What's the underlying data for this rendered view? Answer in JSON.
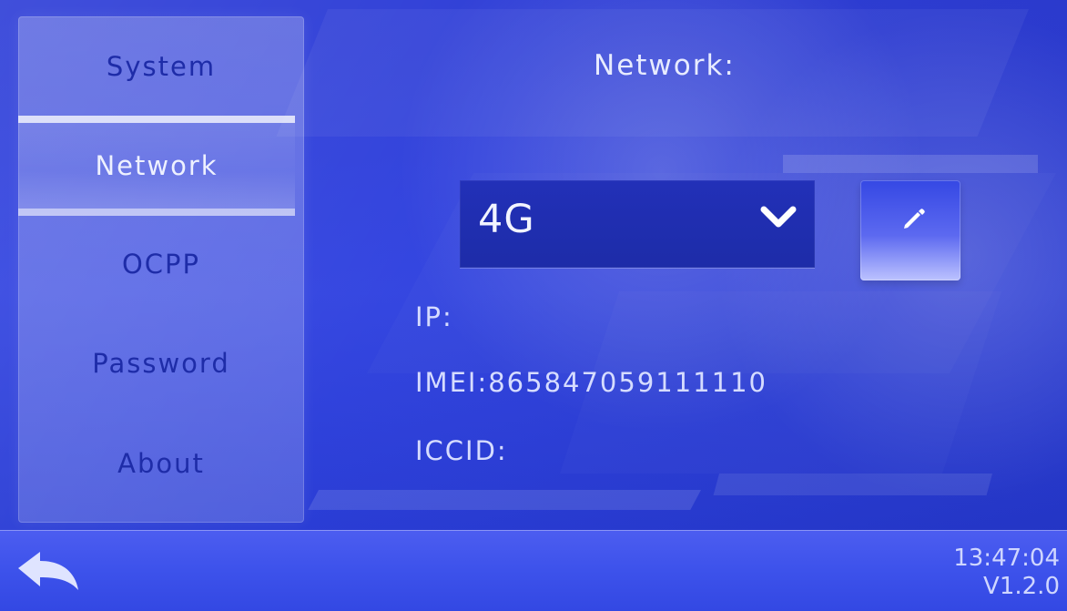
{
  "sidebar": {
    "items": [
      {
        "label": "System"
      },
      {
        "label": "Network"
      },
      {
        "label": "OCPP"
      },
      {
        "label": "Password"
      },
      {
        "label": "About"
      }
    ],
    "selected": "Network"
  },
  "main": {
    "title": "Network:",
    "network_type": {
      "value": "4G",
      "icon": "chevron-down-icon"
    },
    "edit_icon": "pencil-icon",
    "info": {
      "ip": "IP:",
      "imei": "IMEI:865847059111110",
      "iccid": "ICCID:"
    }
  },
  "footer": {
    "back_icon": "back-arrow-icon",
    "time": "13:47:04",
    "version": "V1.2.0"
  },
  "colors": {
    "background": "#2b3bd6",
    "sidebar_text": "#1e2ca8",
    "selected_text": "#eef1ff",
    "accent": "#1d2ca8",
    "footer": "#3d52eb",
    "text": "#e7ebff"
  }
}
